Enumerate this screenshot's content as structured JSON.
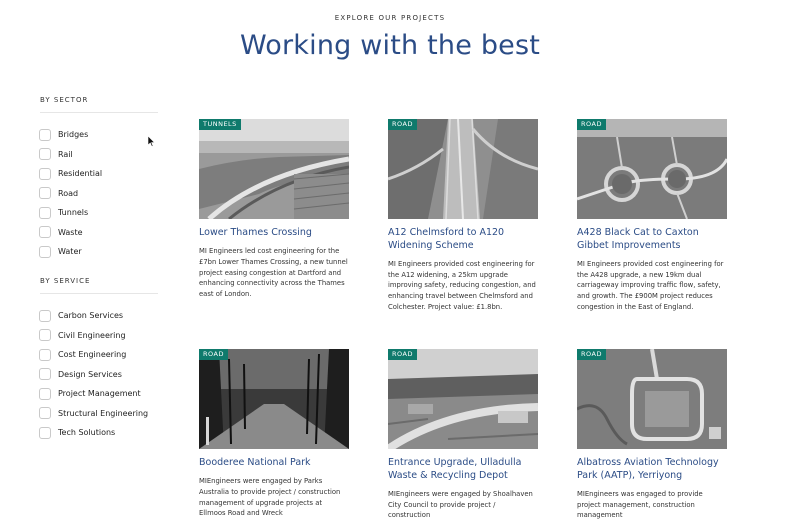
{
  "header": {
    "eyebrow": "EXPLORE OUR PROJECTS",
    "title": "Working with the best"
  },
  "filters": {
    "sector": {
      "heading": "BY SECTOR",
      "options": [
        "Bridges",
        "Rail",
        "Residential",
        "Road",
        "Tunnels",
        "Waste",
        "Water"
      ]
    },
    "service": {
      "heading": "BY SERVICE",
      "options": [
        "Carbon Services",
        "Civil Engineering",
        "Cost Engineering",
        "Design Services",
        "Project Management",
        "Structural Engineering",
        "Tech Solutions"
      ]
    }
  },
  "projects": [
    {
      "tag": "TUNNELS",
      "title": "Lower Thames Crossing",
      "description": "MI Engineers led cost engineering for the £7bn Lower Thames Crossing, a new tunnel project easing congestion at Dartford and enhancing connectivity across the Thames east of London."
    },
    {
      "tag": "ROAD",
      "title": "A12 Chelmsford to A120 Widening Scheme",
      "description": "MI Engineers provided cost engineering for the A12 widening, a 25km upgrade improving safety, reducing congestion, and enhancing travel between Chelmsford and Colchester. Project value: £1.8bn."
    },
    {
      "tag": "ROAD",
      "title": "A428 Black Cat to Caxton Gibbet Improvements",
      "description": "MI Engineers provided cost engineering for the A428 upgrade, a new 19km dual carriageway improving traffic flow, safety, and growth. The £900M project reduces congestion in the East of England."
    },
    {
      "tag": "ROAD",
      "title": "Booderee National Park",
      "description": "MIEngineers were engaged by Parks Australia to provide project / construction management of upgrade projects at Ellmoos Road and Wreck"
    },
    {
      "tag": "ROAD",
      "title": "Entrance Upgrade, Ulladulla Waste & Recycling Depot",
      "description": "MIEngineers were engaged by Shoalhaven City Council to provide project / construction"
    },
    {
      "tag": "ROAD",
      "title": "Albatross Aviation Technology Park (AATP), Yerriyong",
      "description": "MIEngineers was engaged to provide project management, construction management"
    }
  ]
}
